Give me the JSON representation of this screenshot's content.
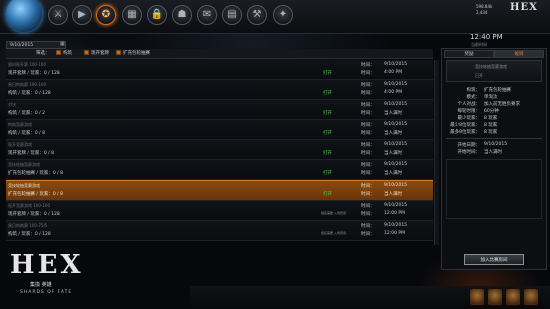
{
  "nav": {
    "icons": [
      "game-icon",
      "play-icon",
      "tournament-icon",
      "collection-icon",
      "lock-icon",
      "bag-icon",
      "chat-icon",
      "document-icon",
      "tools-icon",
      "inbox-icon"
    ],
    "coins": [
      "598.84k",
      "2,434"
    ],
    "logo": "HEX",
    "clock": "12:40 PM",
    "clock_sub": "当前时间"
  },
  "filters": {
    "date": "9/10/2015",
    "label": "筛选：",
    "items": [
      "构筑",
      "现开套牌",
      "扩充包轮抽赛"
    ]
  },
  "events": [
    {
      "title": "限时现开赛 100-100",
      "detail": "现开套牌 / 玩家：0 / 128",
      "status": "打开",
      "tl1": "时间：",
      "tv1": "9/10/2015",
      "tl2": "时间：",
      "tv2": "4:00 PM"
    },
    {
      "title": "周日构筑赛 100-100",
      "detail": "构筑 / 玩家：0 / 128",
      "status": "打开",
      "tl1": "时间：",
      "tv1": "9/10/2015",
      "tl2": "时间：",
      "tv2": "4:00 PM"
    },
    {
      "title": "对决",
      "detail": "构筑 / 玩家：0 / 2",
      "status": "打开",
      "tl1": "时间：",
      "tv1": "9/10/2015",
      "tl2": "时间：",
      "tv2": "当人满时"
    },
    {
      "title": "构筑竞赛游戏",
      "detail": "构筑 / 玩家：0 / 8",
      "status": "打开",
      "tl1": "时间：",
      "tv1": "9/10/2015",
      "tl2": "时间：",
      "tv2": "当人满时"
    },
    {
      "title": "现开竞赛游戏",
      "detail": "现开套牌 / 玩家：0 / 8",
      "status": "打开",
      "tl1": "时间：",
      "tv1": "9/10/2015",
      "tl2": "时间：",
      "tv2": "当人满时"
    },
    {
      "title": "竞技轮抽竞赛游戏",
      "detail": "扩充包轮抽赛 / 玩家：0 / 8",
      "status": "打开",
      "tl1": "时间：",
      "tv1": "9/10/2015",
      "tl2": "时间：",
      "tv2": "当人满时"
    },
    {
      "title": "竞技轮抽竞赛游戏",
      "detail": "扩充包轮抽赛 / 玩家：0 / 8",
      "status": "打开",
      "tl1": "时间：",
      "tv1": "9/10/2015",
      "tl2": "时间：",
      "tv2": "当人满时",
      "selected": true
    },
    {
      "title": "现开竞赛游戏 100-100",
      "detail": "现开套牌 / 玩家：0 / 128",
      "note": "报名需要 入场费用",
      "tl1": "时间：",
      "tv1": "9/10/2015",
      "tl2": "时间：",
      "tv2": "12:00 PM"
    },
    {
      "title": "周日构筑赛 100-75/5",
      "detail": "构筑 / 玩家：0 / 128",
      "note": "报名需要 入场费用",
      "tl1": "时间：",
      "tv1": "9/10/2015",
      "tl2": "时间：",
      "tv2": "12:00 PM"
    }
  ],
  "details": {
    "tabs": [
      "奖励",
      "规则"
    ],
    "box_line1": "竞技轮抽竞赛游戏",
    "box_line2": "已开",
    "fields": [
      {
        "k": "构筑：",
        "v": "扩充包轮抽赛"
      },
      {
        "k": "模式：",
        "v": "单淘汰"
      },
      {
        "k": "个人对战：",
        "v": "加入前无胜负要求"
      },
      {
        "k": "每轮时限：",
        "v": "60分钟"
      },
      {
        "k": "最少玩家：",
        "v": "8 玩家"
      },
      {
        "k": "最少8位玩家：",
        "v": "8 玩家"
      },
      {
        "k": "最多8位玩家：",
        "v": "8 玩家"
      }
    ],
    "schedule": [
      {
        "k": "开始日期：",
        "v": "9/10/2015"
      },
      {
        "k": "开始时间：",
        "v": "当人满时"
      }
    ],
    "join": "加入比赛房间"
  },
  "brand": {
    "logo": "HEX",
    "sub_cn": "集換 英雄",
    "sub_en": "SHARDS OF FATE"
  }
}
